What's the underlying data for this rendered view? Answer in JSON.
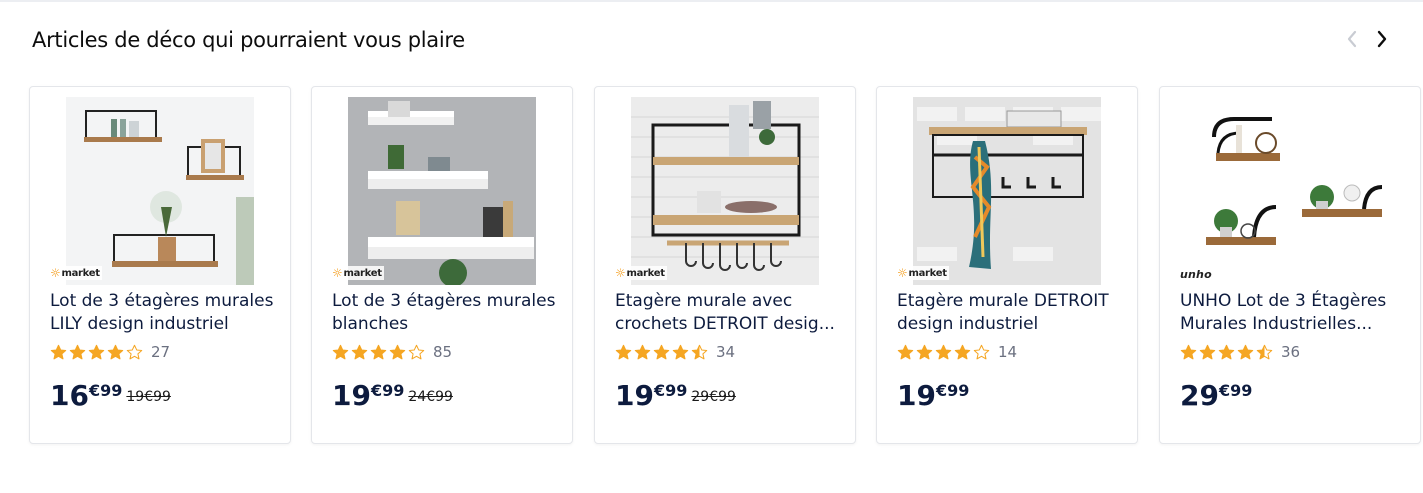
{
  "section": {
    "title": "Articles de déco qui pourraient vous plaire"
  },
  "nav": {
    "prev_icon": "chevron-left-icon",
    "next_icon": "chevron-right-icon"
  },
  "colors": {
    "star": "#f5a623",
    "text": "#0d1b3e",
    "brand_accent": "#f29100"
  },
  "products": [
    {
      "brand": "market",
      "brand_logo": "idmarket-logo",
      "title": "Lot de 3 étagères murales LILY design industriel",
      "rating": 4,
      "reviews": "27",
      "price_int": "16",
      "price_dec": "€99",
      "old_price": "19€99"
    },
    {
      "brand": "market",
      "brand_logo": "idmarket-logo",
      "title": "Lot de 3 étagères murales blanches",
      "rating": 4,
      "reviews": "85",
      "price_int": "19",
      "price_dec": "€99",
      "old_price": "24€99"
    },
    {
      "brand": "market",
      "brand_logo": "idmarket-logo",
      "title": "Etagère murale avec crochets DETROIT desig...",
      "rating": 4.5,
      "reviews": "34",
      "price_int": "19",
      "price_dec": "€99",
      "old_price": "29€99"
    },
    {
      "brand": "market",
      "brand_logo": "idmarket-logo",
      "title": "Etagère murale DETROIT design industriel",
      "rating": 4,
      "reviews": "14",
      "price_int": "19",
      "price_dec": "€99",
      "old_price": ""
    },
    {
      "brand": "unho",
      "brand_logo": "unho-logo",
      "title": "UNHO Lot de 3 Étagères Murales Industrielles...",
      "rating": 4.5,
      "reviews": "36",
      "price_int": "29",
      "price_dec": "€99",
      "old_price": ""
    }
  ]
}
